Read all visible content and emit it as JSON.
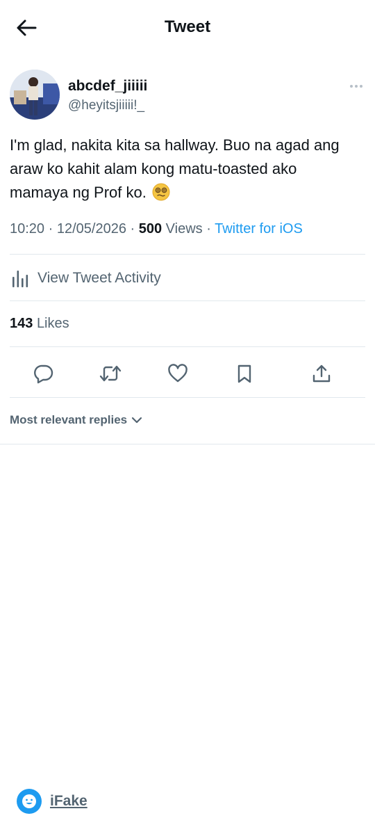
{
  "header": {
    "title": "Tweet"
  },
  "author": {
    "display_name": "abcdef_jiiiii",
    "handle": "@heyitsjiiiii!_"
  },
  "tweet": {
    "text": "I'm glad, nakita kita sa hallway. Buo na agad ang araw ko kahit alam kong matu-toasted ako mamaya ng Prof ko."
  },
  "meta": {
    "time": "10:20",
    "date": "12/05/2026",
    "views_count": "500",
    "views_label": "Views",
    "source": "Twitter for iOS",
    "sep": " · "
  },
  "activity": {
    "label": "View Tweet Activity"
  },
  "likes": {
    "count": "143",
    "label": "Likes"
  },
  "replies": {
    "sort_label": "Most relevant replies"
  },
  "watermark": {
    "brand": "iFake"
  },
  "icons": {
    "back": "arrow-left-icon",
    "more": "more-dots-icon",
    "activity": "bar-chart-icon",
    "reply": "reply-bubble-icon",
    "retweet": "retweet-icon",
    "like": "heart-icon",
    "bookmark": "bookmark-icon",
    "share": "share-icon",
    "emoji": "dizzy-face-emoji",
    "sort": "chevron-down-icon",
    "logo": "ifake-logo-icon"
  },
  "colors": {
    "accent": "#1d9bf0",
    "secondary": "#536471",
    "text": "#0f1419",
    "divider": "#e1e8ed"
  }
}
